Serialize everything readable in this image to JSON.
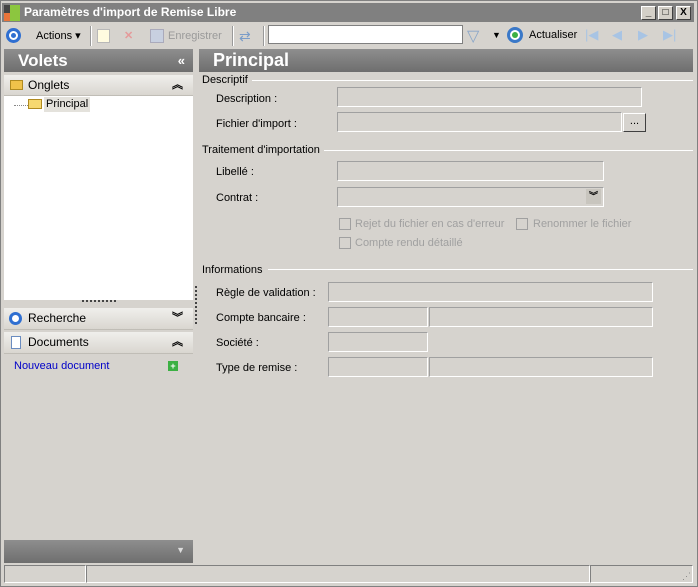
{
  "window": {
    "title": "Paramètres d'import de Remise Libre",
    "min": "_",
    "max": "□",
    "close": "X"
  },
  "toolbar": {
    "actions": "Actions",
    "save": "Enregistrer",
    "search_value": "",
    "refresh": "Actualiser"
  },
  "left": {
    "title": "Volets",
    "collapse": "«",
    "sections": [
      {
        "label": "Onglets",
        "chev": "︽"
      },
      {
        "label": "Recherche",
        "chev": "︾"
      },
      {
        "label": "Documents",
        "chev": "︽"
      }
    ],
    "tree": [
      {
        "label": "Principal"
      }
    ],
    "new_document": "Nouveau document"
  },
  "main": {
    "title": "Principal",
    "descriptif": {
      "title": "Descriptif",
      "description": "Description :",
      "fichier": "Fichier d'import :",
      "browse": "..."
    },
    "traitement": {
      "title": "Traitement d'importation",
      "libelle": "Libellé :",
      "contrat": "Contrat  :",
      "rejet": "Rejet du fichier en cas d'erreur",
      "renommer": "Renommer le fichier",
      "compte_rendu": "Compte rendu détaillé"
    },
    "informations": {
      "title": "Informations",
      "regle": "Règle de validation :",
      "compte": "Compte bancaire :",
      "societe": "Société :",
      "type": "Type de remise :"
    }
  }
}
